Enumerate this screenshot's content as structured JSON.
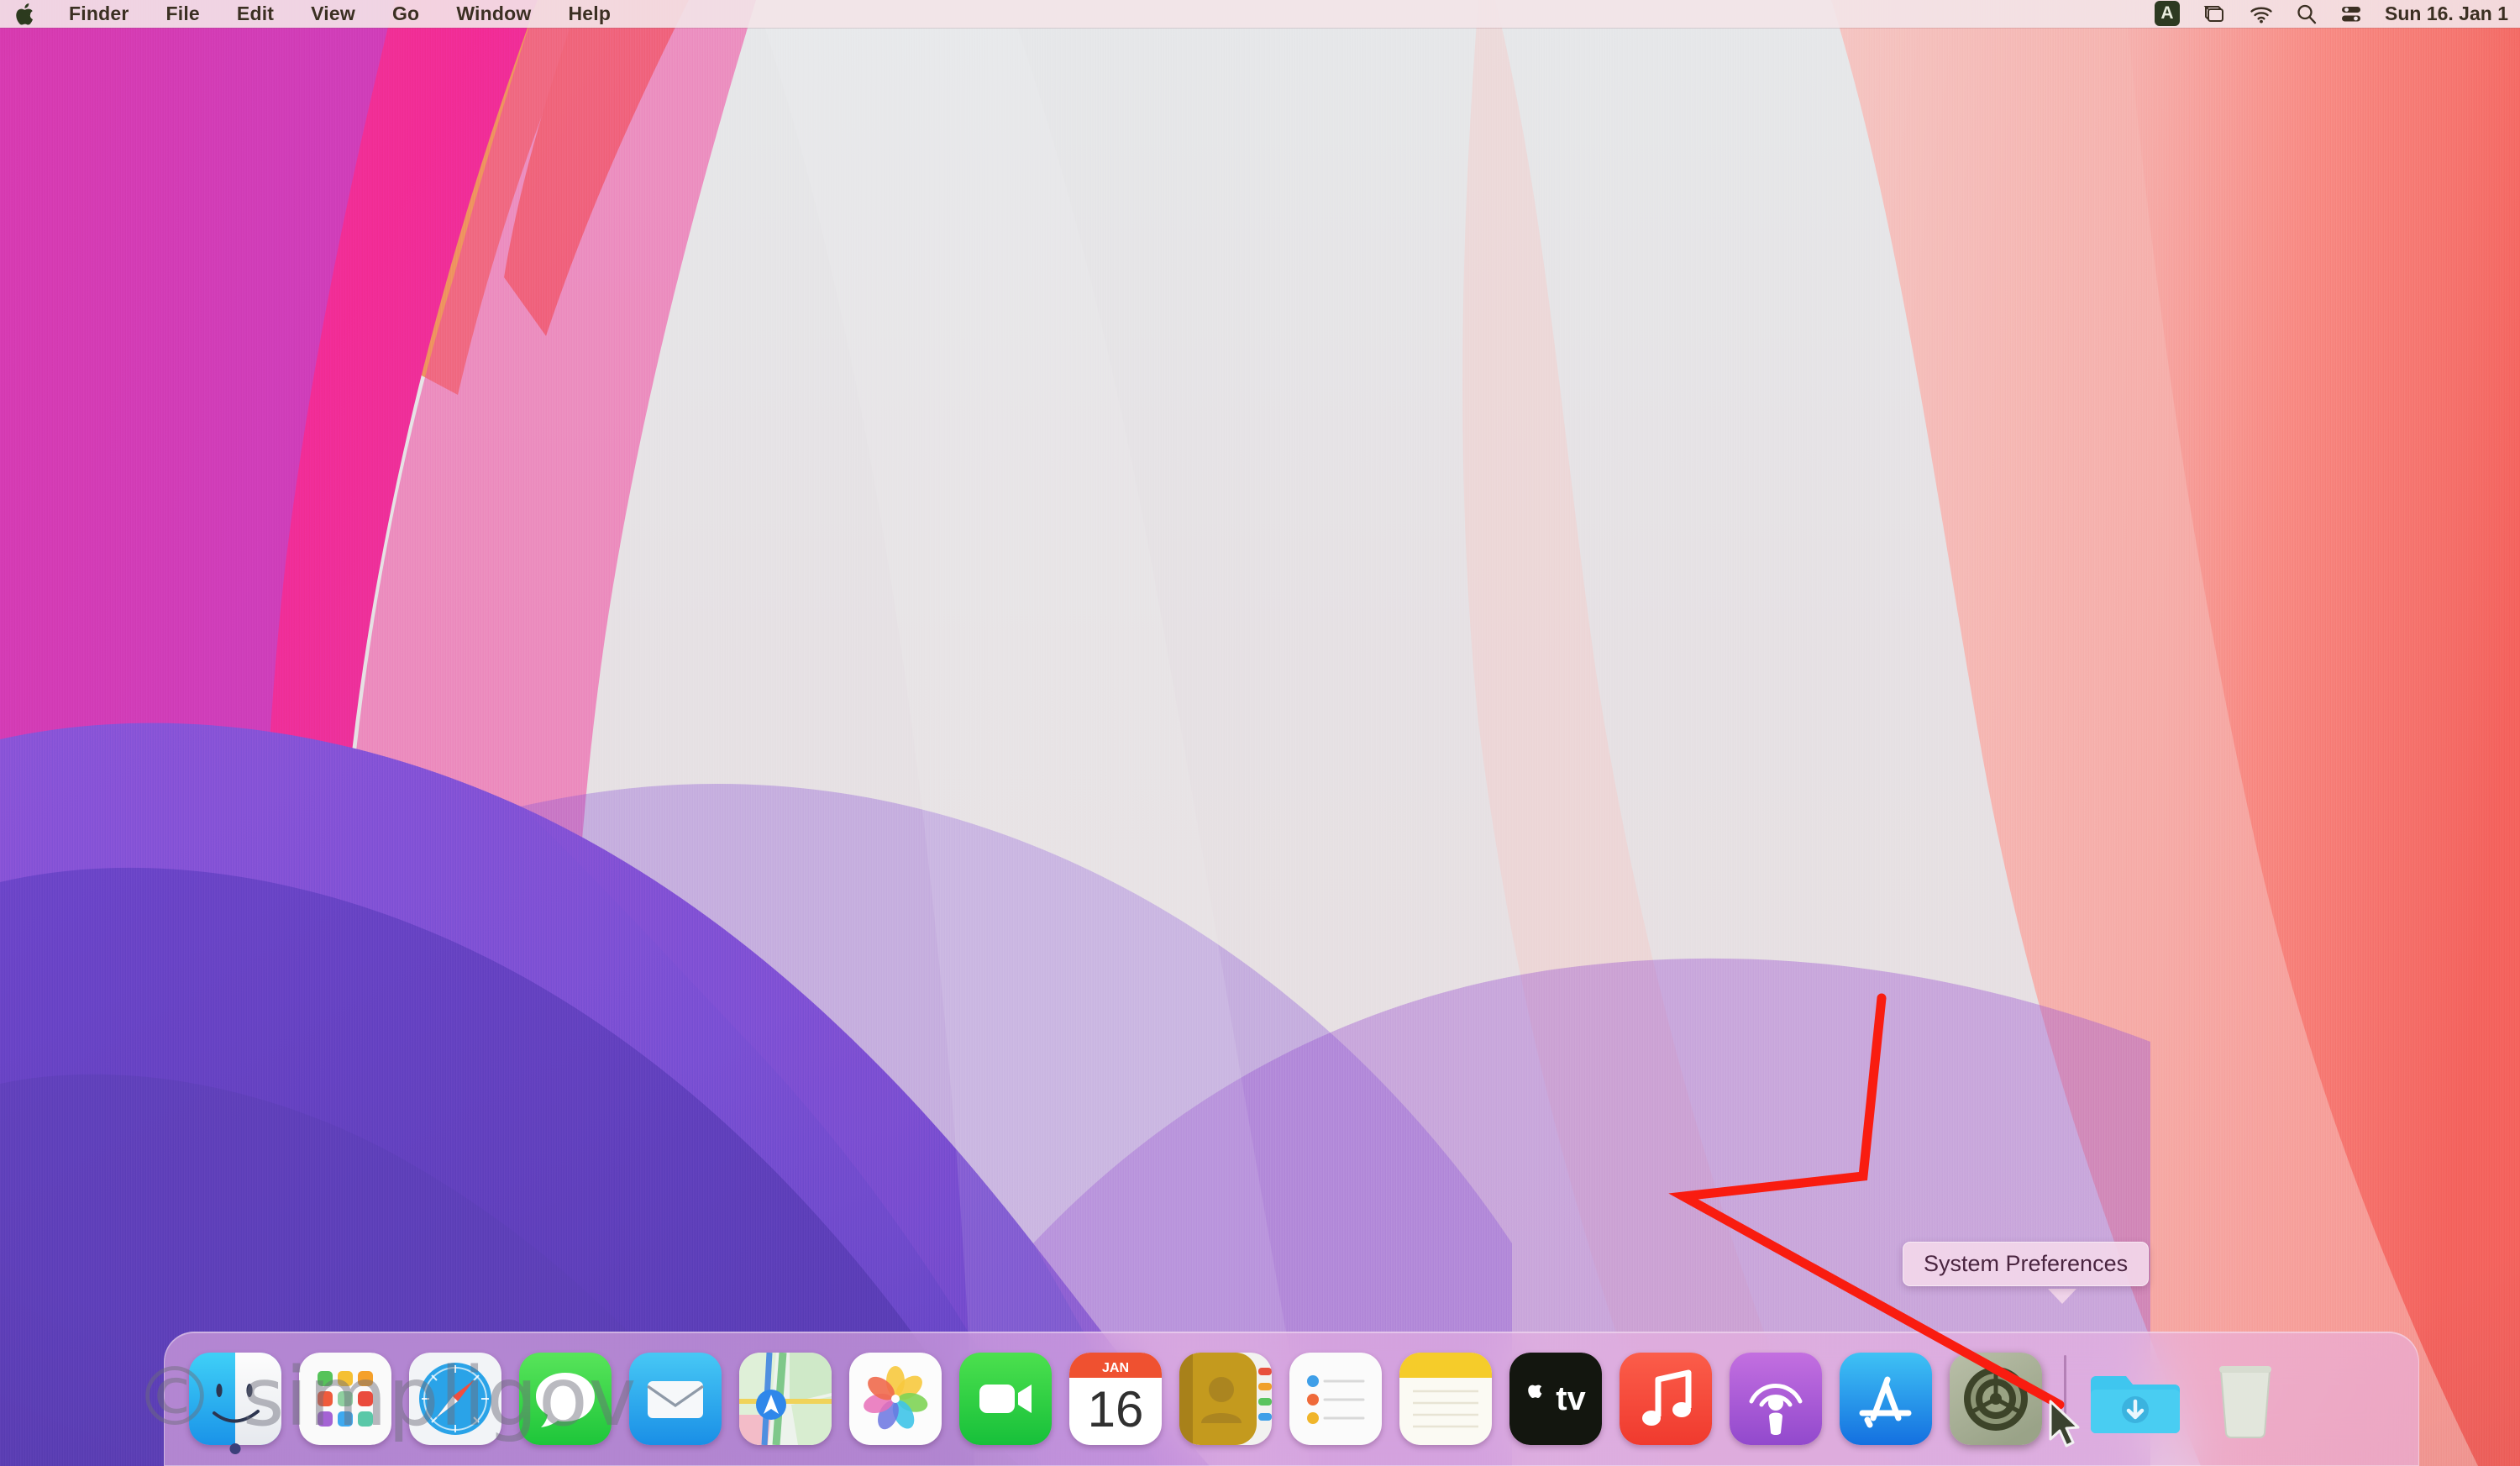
{
  "menubar": {
    "apple_icon": "apple-logo-icon",
    "items": [
      {
        "label": "Finder",
        "active": true
      },
      {
        "label": "File",
        "active": false
      },
      {
        "label": "Edit",
        "active": false
      },
      {
        "label": "View",
        "active": false
      },
      {
        "label": "Go",
        "active": false
      },
      {
        "label": "Window",
        "active": false
      },
      {
        "label": "Help",
        "active": false
      }
    ],
    "status_items": [
      {
        "name": "input-source-badge",
        "label": "A"
      },
      {
        "name": "screen-mirroring-icon",
        "label": ""
      },
      {
        "name": "wifi-icon",
        "label": ""
      },
      {
        "name": "spotlight-search-icon",
        "label": ""
      },
      {
        "name": "control-center-icon",
        "label": ""
      }
    ],
    "clock": "Sun 16. Jan  1"
  },
  "dock": {
    "items": [
      {
        "name": "finder",
        "label": "Finder",
        "running": true
      },
      {
        "name": "launchpad",
        "label": "Launchpad",
        "running": false
      },
      {
        "name": "safari",
        "label": "Safari",
        "running": false
      },
      {
        "name": "messages",
        "label": "Messages",
        "running": false
      },
      {
        "name": "mail",
        "label": "Mail",
        "running": false
      },
      {
        "name": "maps",
        "label": "Maps",
        "running": false
      },
      {
        "name": "photos",
        "label": "Photos",
        "running": false
      },
      {
        "name": "facetime",
        "label": "FaceTime",
        "running": false
      },
      {
        "name": "calendar",
        "label": "Calendar",
        "running": false,
        "month": "JAN",
        "day": "16"
      },
      {
        "name": "contacts",
        "label": "Contacts",
        "running": false
      },
      {
        "name": "reminders",
        "label": "Reminders",
        "running": false
      },
      {
        "name": "notes",
        "label": "Notes",
        "running": false
      },
      {
        "name": "appletv",
        "label": "TV",
        "running": false
      },
      {
        "name": "music",
        "label": "Music",
        "running": false
      },
      {
        "name": "podcasts",
        "label": "Podcasts",
        "running": false
      },
      {
        "name": "appstore",
        "label": "App Store",
        "running": false
      },
      {
        "name": "system-preferences",
        "label": "System Preferences",
        "running": false
      },
      {
        "name": "separator",
        "label": "",
        "running": false
      },
      {
        "name": "downloads-folder",
        "label": "Downloads",
        "running": false
      },
      {
        "name": "trash",
        "label": "Trash",
        "running": false
      }
    ]
  },
  "tooltip": {
    "text": "System Preferences"
  },
  "annotation": {
    "color": "#f91c10",
    "shape": "hand-drawn-arrow-pointing-to-system-preferences"
  },
  "watermark": {
    "text": "© simpligov"
  },
  "colors": {
    "menubar_bg": "#f3e4e8",
    "dock_bg": "#e9b2e2",
    "annotation_red": "#f91c10",
    "tooltip_bg": "#f2d6ea",
    "wallpaper_pink": "#f5358f",
    "wallpaper_purple": "#6a4fd0",
    "wallpaper_coral": "#f8736e",
    "wallpaper_cream": "#e8e2e6"
  }
}
